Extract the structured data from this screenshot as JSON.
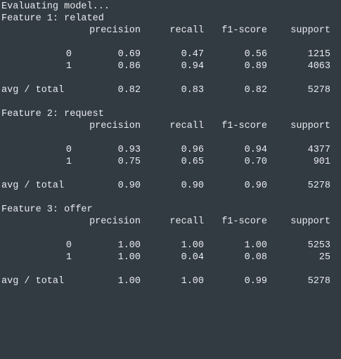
{
  "header": "Evaluating model...",
  "columns": [
    "precision",
    "recall",
    "f1-score",
    "support"
  ],
  "reports": [
    {
      "title": "Feature 1: related",
      "rows": [
        {
          "label": "0",
          "precision": "0.69",
          "recall": "0.47",
          "f1": "0.56",
          "support": "1215"
        },
        {
          "label": "1",
          "precision": "0.86",
          "recall": "0.94",
          "f1": "0.89",
          "support": "4063"
        }
      ],
      "avg": {
        "label": "avg / total",
        "precision": "0.82",
        "recall": "0.83",
        "f1": "0.82",
        "support": "5278"
      }
    },
    {
      "title": "Feature 2: request",
      "rows": [
        {
          "label": "0",
          "precision": "0.93",
          "recall": "0.96",
          "f1": "0.94",
          "support": "4377"
        },
        {
          "label": "1",
          "precision": "0.75",
          "recall": "0.65",
          "f1": "0.70",
          "support": "901"
        }
      ],
      "avg": {
        "label": "avg / total",
        "precision": "0.90",
        "recall": "0.90",
        "f1": "0.90",
        "support": "5278"
      }
    },
    {
      "title": "Feature 3: offer",
      "rows": [
        {
          "label": "0",
          "precision": "1.00",
          "recall": "1.00",
          "f1": "1.00",
          "support": "5253"
        },
        {
          "label": "1",
          "precision": "1.00",
          "recall": "0.04",
          "f1": "0.08",
          "support": "25"
        }
      ],
      "avg": {
        "label": "avg / total",
        "precision": "1.00",
        "recall": "1.00",
        "f1": "0.99",
        "support": "5278"
      }
    }
  ]
}
